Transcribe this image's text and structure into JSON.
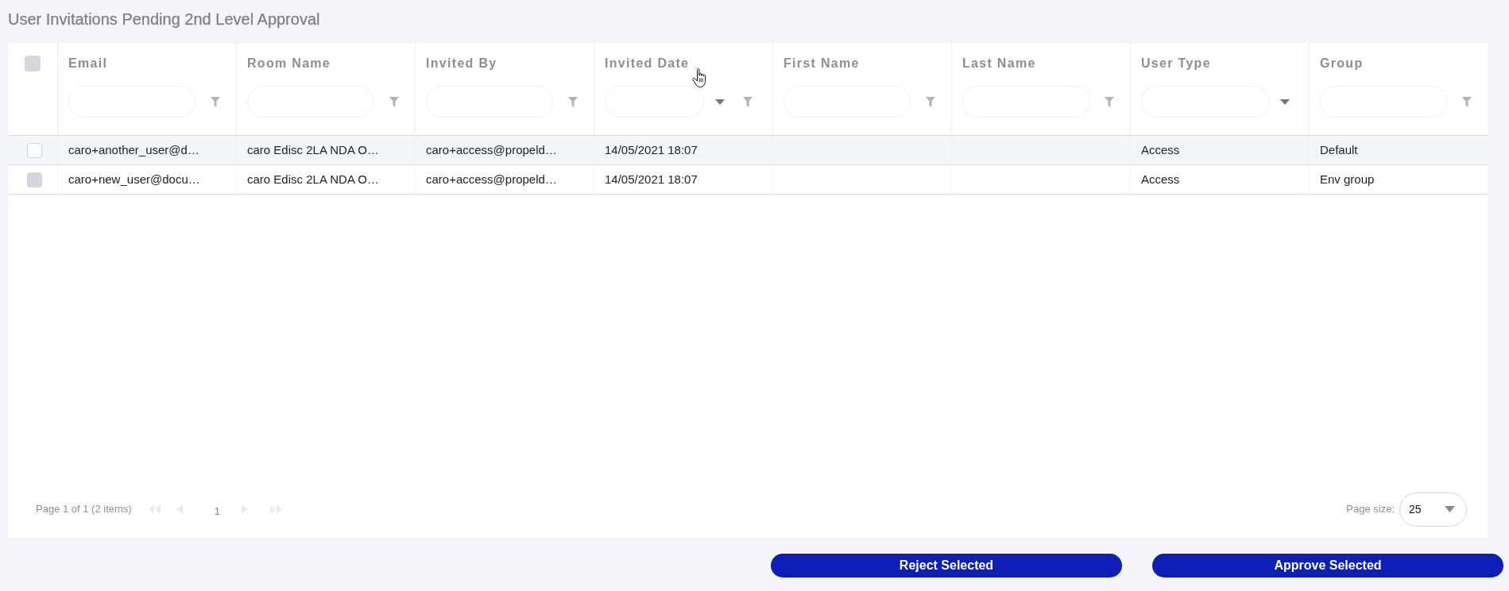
{
  "title": "User Invitations Pending 2nd Level Approval",
  "table": {
    "select_all_checked": false,
    "columns": [
      {
        "label": "Email",
        "kind": "text"
      },
      {
        "label": "Room Name",
        "kind": "text"
      },
      {
        "label": "Invited By",
        "kind": "text"
      },
      {
        "label": "Invited Date",
        "kind": "date"
      },
      {
        "label": "First Name",
        "kind": "text"
      },
      {
        "label": "Last Name",
        "kind": "text"
      },
      {
        "label": "User Type",
        "kind": "select"
      },
      {
        "label": "Group",
        "kind": "text"
      }
    ],
    "rows": [
      {
        "highlighted": true,
        "checked": false,
        "email": "caro+another_user@d…",
        "room_name": "caro Edisc 2LA NDA O…",
        "invited_by": "caro+access@propeld…",
        "invited_date": "14/05/2021 18:07",
        "user_type": "Access",
        "group": "Default"
      },
      {
        "highlighted": false,
        "checked": false,
        "email": "caro+new_user@docu…",
        "room_name": "caro Edisc 2LA NDA O…",
        "invited_by": "caro+access@propeld…",
        "invited_date": "14/05/2021 18:07",
        "user_type": "Access",
        "group": "Env group"
      }
    ]
  },
  "pager": {
    "summary": "Page 1 of 1 (2 items)",
    "navigation": [
      {
        "kind": "first",
        "disabled": true
      },
      {
        "kind": "previous",
        "disabled": true
      },
      {
        "kind": "next",
        "disabled": true
      },
      {
        "kind": "last",
        "disabled": true
      }
    ],
    "current_page": "1",
    "page_size_label": "Page size:",
    "page_size": "25"
  },
  "buttons": [
    "Reject Selected",
    "Approve Selected"
  ]
}
